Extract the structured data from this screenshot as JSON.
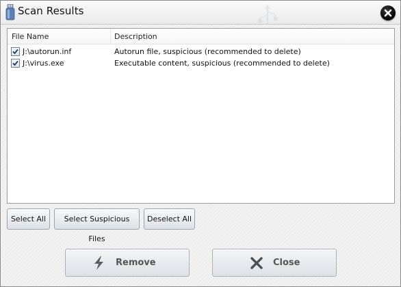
{
  "window": {
    "title": "Scan Results"
  },
  "list": {
    "columns": {
      "name": "File Name",
      "description": "Description"
    },
    "rows": [
      {
        "checked": true,
        "file": "J:\\autorun.inf",
        "description": "Autorun file, suspicious (recommended to delete)"
      },
      {
        "checked": true,
        "file": "J:\\virus.exe",
        "description": "Executable content, suspicious (recommended to delete)"
      }
    ]
  },
  "buttons": {
    "select_all": "Select All",
    "select_suspicious": "Select Suspicious Files",
    "deselect_all": "Deselect All",
    "remove": "Remove",
    "close": "Close"
  },
  "icons": {
    "app": "usb-drive-icon",
    "title_close": "close-circle-icon",
    "checkbox": "checkmark-icon",
    "remove": "lightning-bolt-icon",
    "close": "x-icon"
  },
  "colors": {
    "window_bg": "#efefef",
    "close_circle": "#000000",
    "big_button_text": "#555555",
    "checkbox_border": "#6f7c8c"
  }
}
